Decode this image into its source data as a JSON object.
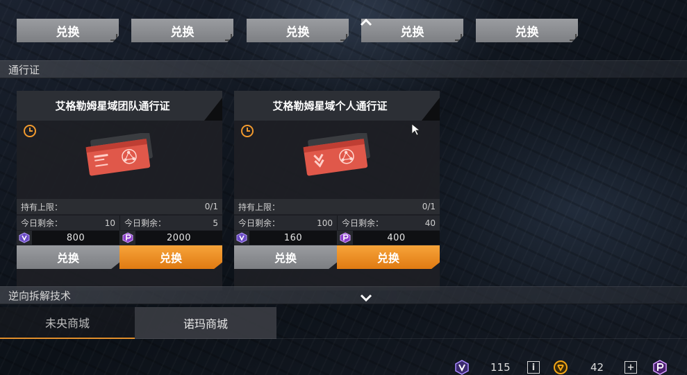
{
  "top_row": {
    "buttons": [
      "兑换",
      "兑换",
      "兑换",
      "兑换",
      "兑换"
    ]
  },
  "sections": {
    "pass": "通行证",
    "reverse": "逆向拆解技术"
  },
  "cards": [
    {
      "title": "艾格勒姆星域团队通行证",
      "limit_label": "持有上限：",
      "limit_value": "0/1",
      "remain_a_label": "今日剩余：",
      "remain_a_value": "10",
      "remain_b_label": "今日剩余：",
      "remain_b_value": "5",
      "price_a": "800",
      "price_b": "2000",
      "btn_a": "兑换",
      "btn_b": "兑换"
    },
    {
      "title": "艾格勒姆星域个人通行证",
      "limit_label": "持有上限：",
      "limit_value": "0/1",
      "remain_a_label": "今日剩余：",
      "remain_a_value": "100",
      "remain_b_label": "今日剩余：",
      "remain_b_value": "40",
      "price_a": "160",
      "price_b": "400",
      "btn_a": "兑换",
      "btn_b": "兑换"
    }
  ],
  "tabs": {
    "tab1": "未央商城",
    "tab2": "诺玛商城"
  },
  "currency": {
    "v_amount": "115",
    "info": "i",
    "gold_amount": "42",
    "add": "+"
  },
  "colors": {
    "accent_orange": "#f29a2e",
    "currency_purple": "#9b6cf0",
    "currency_gold": "#f2a516",
    "button_grey": "#8c8e92"
  }
}
